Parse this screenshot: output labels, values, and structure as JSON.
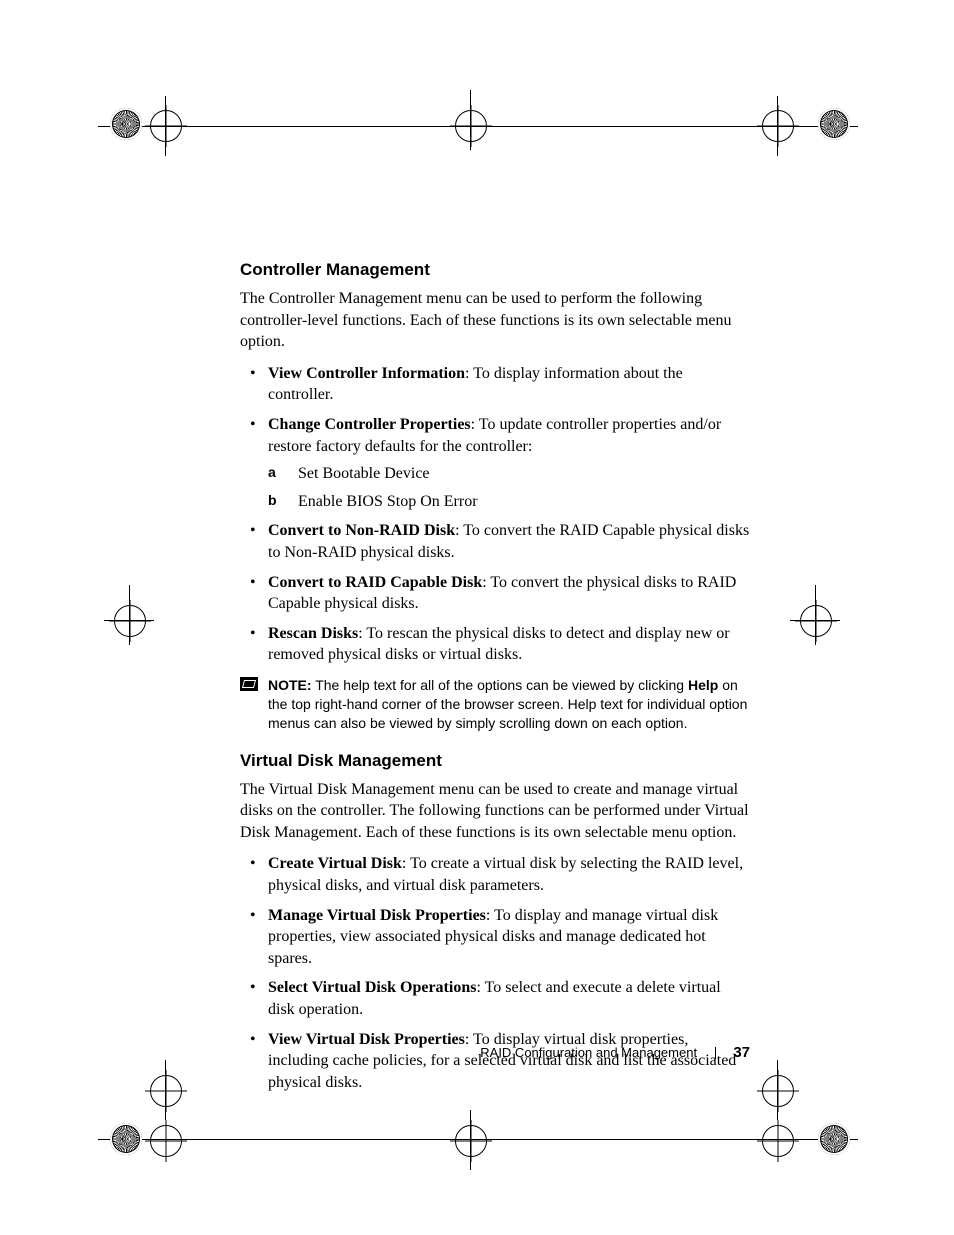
{
  "section1": {
    "heading": "Controller Management",
    "intro": "The Controller Management menu can be used to perform the following controller-level functions. Each of these functions is its own selectable menu option.",
    "items": [
      {
        "lead": "View Controller Information",
        "rest": ": To display information about the controller."
      },
      {
        "lead": "Change Controller Properties",
        "rest": ": To update controller properties and/or restore factory defaults for the controller:",
        "sub": [
          {
            "label": "a",
            "text": "Set Bootable Device"
          },
          {
            "label": "b",
            "text": "Enable BIOS Stop On Error"
          }
        ]
      },
      {
        "lead": "Convert to Non-RAID Disk",
        "rest": ": To convert the RAID Capable physical disks to Non-RAID physical disks."
      },
      {
        "lead": "Convert to RAID Capable Disk",
        "rest": ": To convert the physical disks to RAID Capable physical disks."
      },
      {
        "lead": "Rescan Disks",
        "rest": ": To rescan the physical disks to detect and display new or removed physical disks or virtual disks."
      }
    ]
  },
  "note": {
    "label": "NOTE:",
    "text_before_help": " The help text for all of the options can be viewed by clicking ",
    "help": "Help",
    "text_after_help": " on the top right-hand corner of the browser screen. Help text for individual option menus can also be viewed by simply scrolling down on each option."
  },
  "section2": {
    "heading": "Virtual Disk Management",
    "intro": "The Virtual Disk Management menu can be used to create and manage virtual disks on the controller. The following functions can be performed under Virtual Disk Management. Each of these functions is its own selectable menu option.",
    "items": [
      {
        "lead": "Create Virtual Disk",
        "rest": ": To create a virtual disk by selecting the RAID level, physical disks, and virtual disk parameters."
      },
      {
        "lead": "Manage Virtual Disk Properties",
        "rest": ": To display and manage virtual disk properties, view associated physical disks and manage dedicated hot spares."
      },
      {
        "lead": "Select Virtual Disk Operations",
        "rest": ": To select and execute a delete virtual disk operation."
      },
      {
        "lead": "View Virtual Disk Properties",
        "rest": ": To display virtual disk properties, including cache policies, for a selected virtual disk and list the associated physical disks."
      }
    ]
  },
  "footer": {
    "title": "RAID Configuration and Management",
    "page": "37"
  }
}
